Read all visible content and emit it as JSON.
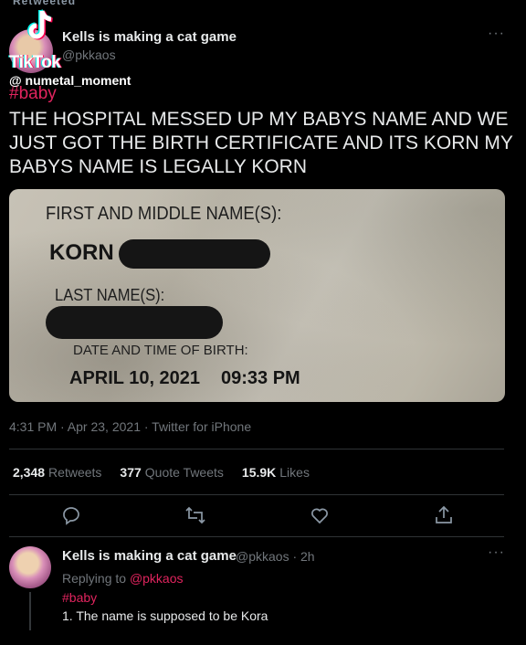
{
  "top_cut_text": "Retweeted",
  "tiktok": {
    "wordmark": "TikTok",
    "handle": "@ numetal_moment"
  },
  "tweet": {
    "author_name": "Kells is making a cat game",
    "author_handle": "@pkkaos",
    "more_label": "···",
    "hashtag": "#baby",
    "text": "THE HOSPITAL MESSED UP MY BABYS NAME AND WE JUST GOT THE BIRTH CERTIFICATE AND ITS KORN MY BABYS NAME IS LEGALLY KORN",
    "photo": {
      "first_middle_label": "FIRST AND MIDDLE NAME(S):",
      "first_name": "KORN",
      "last_name_label": "LAST NAME(S):",
      "dob_label": "DATE AND TIME OF BIRTH:",
      "date": "APRIL 10, 2021",
      "time": "09:33 PM"
    },
    "timestamp": "4:31 PM · Apr 23, 2021 · Twitter for iPhone",
    "stats": [
      {
        "value": "2,348",
        "label": "Retweets"
      },
      {
        "value": "377",
        "label": "Quote Tweets"
      },
      {
        "value": "15.9K",
        "label": "Likes"
      }
    ],
    "actions": [
      "reply-icon",
      "retweet-icon",
      "like-icon",
      "share-icon"
    ]
  },
  "reply": {
    "author_name": "Kells is making a cat game",
    "meta": "@pkkaos · 2h",
    "more_label": "···",
    "replying_prefix": "Replying to",
    "replying_handle": "@pkkaos",
    "hashtag": "#baby",
    "text": "1. The name is supposed to be Kora"
  },
  "colors": {
    "background": "#000000",
    "text": "#e7e9ea",
    "muted": "#71767b",
    "hashtag": "#e0245e",
    "divider": "#2f3336"
  }
}
